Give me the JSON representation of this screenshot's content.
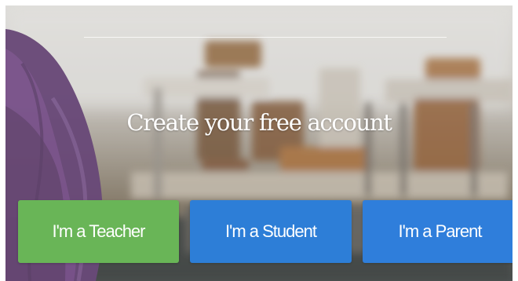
{
  "hero": {
    "title": "Create your free account",
    "accent_colors": {
      "teacher": "#69b557",
      "student": "#2d7ed7",
      "parent": "#2f7edb"
    }
  },
  "buttons": {
    "teacher": "I'm a Teacher",
    "student": "I'm a Student",
    "parent": "I'm a Parent"
  }
}
